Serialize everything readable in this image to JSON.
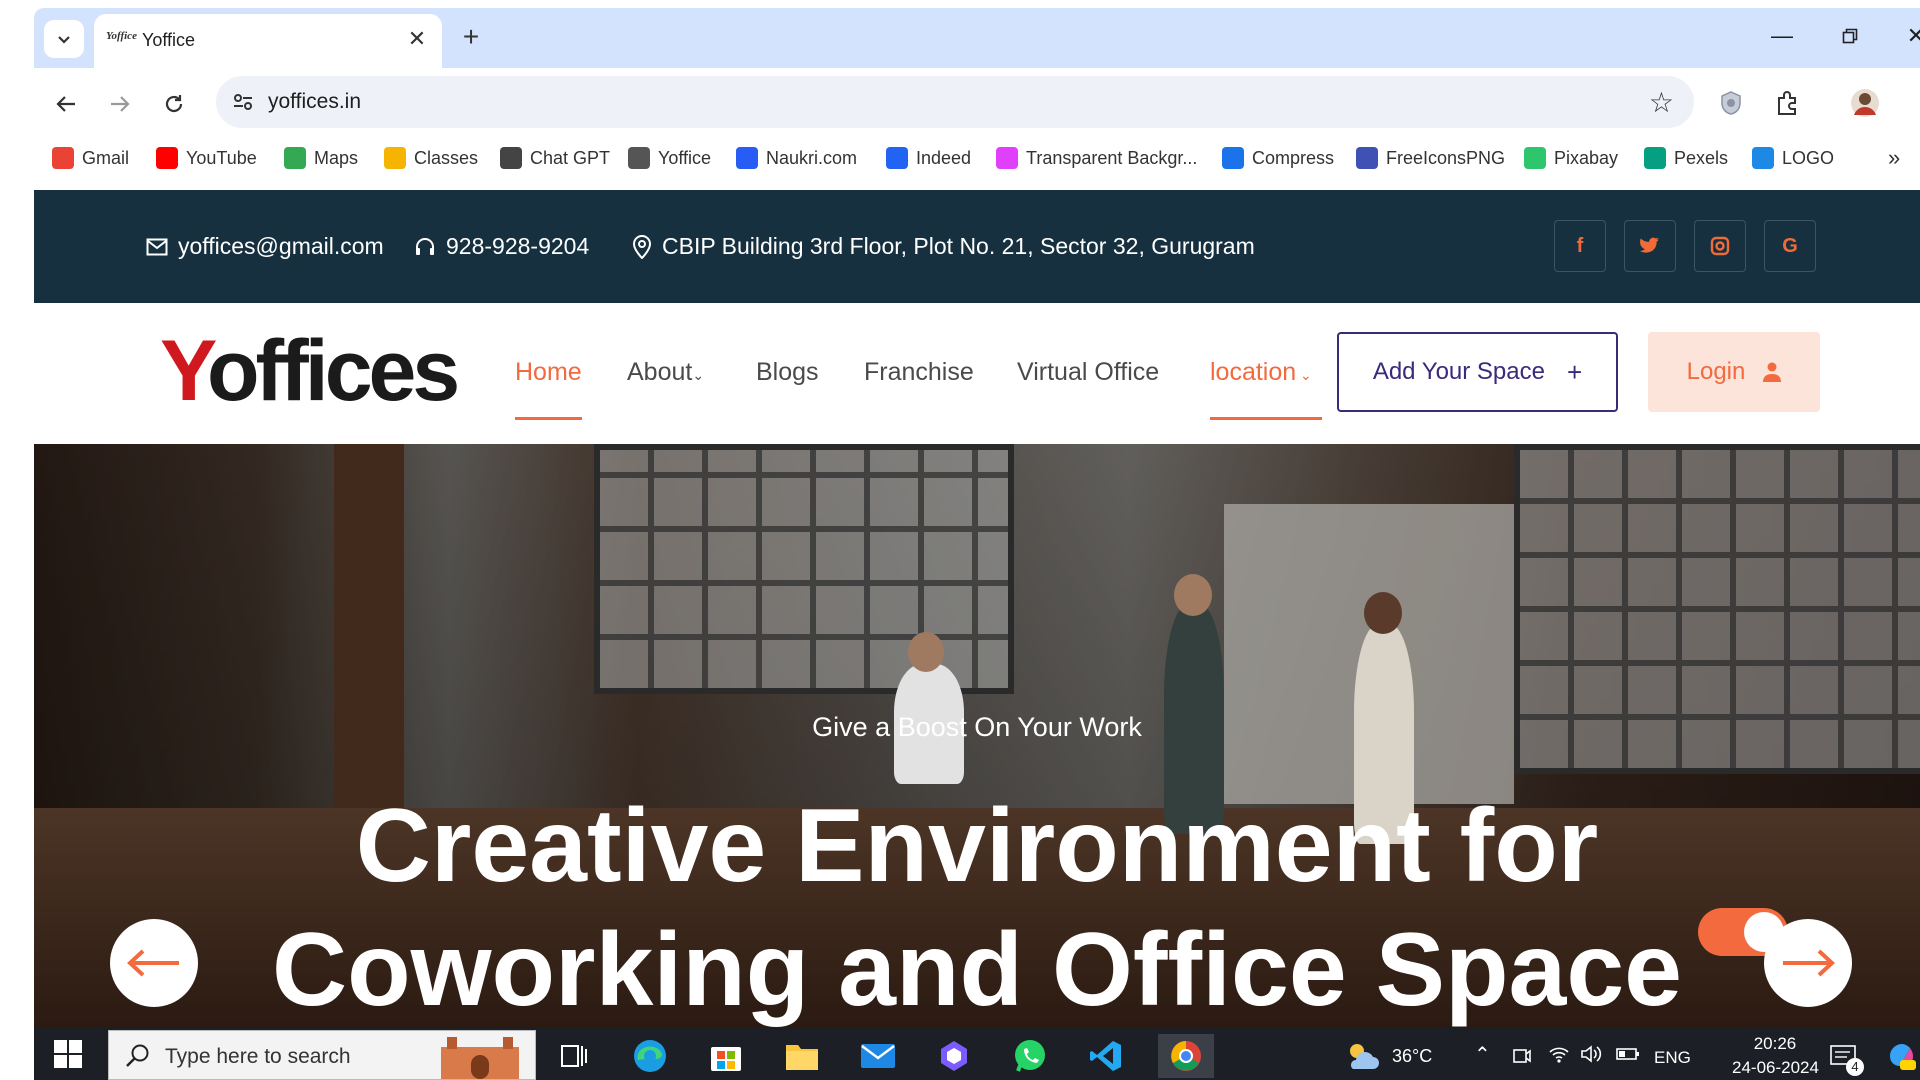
{
  "browser": {
    "tab_title": "Yoffice",
    "tab_favicon": "Yoffice",
    "url": "yoffices.in",
    "bookmarks": [
      {
        "label": "Gmail",
        "icon": "gmail-icon",
        "color": "#ea4335"
      },
      {
        "label": "YouTube",
        "icon": "youtube-icon",
        "color": "#ff0000"
      },
      {
        "label": "Maps",
        "icon": "maps-icon",
        "color": "#34a853"
      },
      {
        "label": "Classes",
        "icon": "classes-icon",
        "color": "#f4b400"
      },
      {
        "label": "Chat GPT",
        "icon": "chatgpt-icon",
        "color": "#444444"
      },
      {
        "label": "Yoffice",
        "icon": "yoffice-icon",
        "color": "#555555"
      },
      {
        "label": "Naukri.com",
        "icon": "naukri-icon",
        "color": "#275df5"
      },
      {
        "label": "Indeed",
        "icon": "indeed-icon",
        "color": "#2164f3"
      },
      {
        "label": "Transparent Backgr...",
        "icon": "transparent-bg-icon",
        "color": "#e040fb"
      },
      {
        "label": "Compress",
        "icon": "compress-icon",
        "color": "#1a73e8"
      },
      {
        "label": "FreeIconsPNG",
        "icon": "freeiconspng-icon",
        "color": "#3f51b5"
      },
      {
        "label": "Pixabay",
        "icon": "pixabay-icon",
        "color": "#2ec66d"
      },
      {
        "label": "Pexels",
        "icon": "pexels-icon",
        "color": "#05a081"
      },
      {
        "label": "LOGO",
        "icon": "logo-icon",
        "color": "#1e88e5"
      }
    ],
    "more_bookmarks": "»"
  },
  "site": {
    "topbar": {
      "email": "yoffices@gmail.com",
      "phone": "928-928-9204",
      "address": "CBIP Building 3rd Floor, Plot No. 21, Sector 32, Gurugram",
      "social": [
        "f",
        "t",
        "ig",
        "G"
      ]
    },
    "logo": {
      "first": "Y",
      "rest": "offices"
    },
    "nav": {
      "home": "Home",
      "about": "About",
      "blogs": "Blogs",
      "franchise": "Franchise",
      "virtual_office": "Virtual Office",
      "location": "location",
      "add_space": "Add Your Space",
      "login": "Login"
    },
    "hero": {
      "subtitle": "Give a Boost On Your Work",
      "title_line1": "Creative Environment for",
      "title_line2": "Coworking and Office Space"
    },
    "accent_color": "#f26a3d",
    "topbar_color": "#16303f"
  },
  "taskbar": {
    "search_placeholder": "Type here to search",
    "temperature": "36°C",
    "language": "ENG",
    "time": "20:26",
    "date": "24-06-2024",
    "notification_count": "4"
  }
}
